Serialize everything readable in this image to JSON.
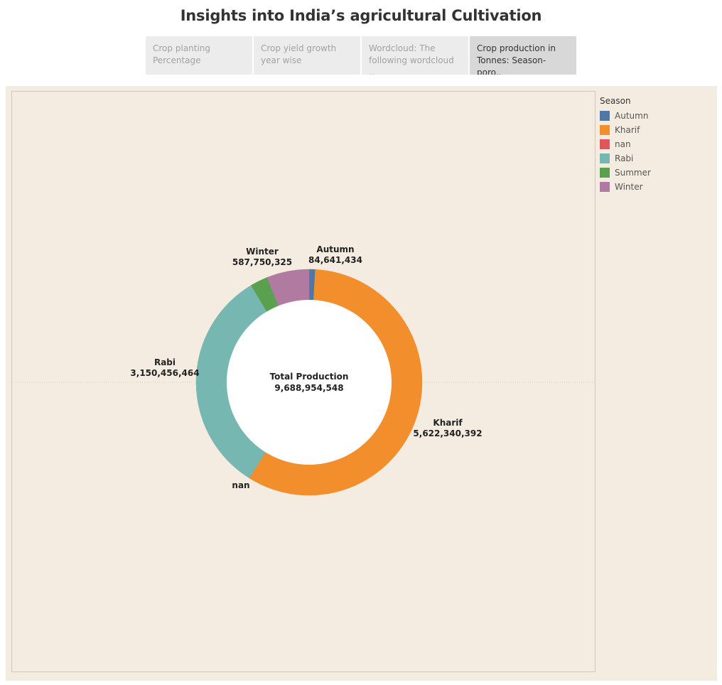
{
  "title": "Insights into India’s agricultural Cultivation",
  "tabs": [
    {
      "label": "Crop planting Percentage",
      "active": false
    },
    {
      "label": "Crop yield growth year wise",
      "active": false
    },
    {
      "label": "Wordcloud: The following wordcloud ..",
      "active": false
    },
    {
      "label": "Crop production in Tonnes: Season-poro..",
      "active": true
    }
  ],
  "colors": {
    "background": "#f5ece1",
    "Autumn": "#4e79a7",
    "Kharif": "#f28e2b",
    "nan": "#e15759",
    "Rabi": "#76b7b2",
    "Summer": "#59a14f",
    "Winter": "#b07aa1"
  },
  "legend": {
    "title": "Season",
    "items": [
      "Autumn",
      "Kharif",
      "nan",
      "Rabi",
      "Summer",
      "Winter"
    ]
  },
  "chart_data": {
    "type": "pie",
    "subtype": "donut",
    "center_label": "Total Production",
    "center_value": "9,688,954,548",
    "total": 9688954548,
    "slices": [
      {
        "name": "Autumn",
        "value": 84641434,
        "label": "84,641,434"
      },
      {
        "name": "Kharif",
        "value": 5622340392,
        "label": "5,622,340,392"
      },
      {
        "name": "nan",
        "value": 0,
        "label": ""
      },
      {
        "name": "Rabi",
        "value": 3150456464,
        "label": "3,150,456,464"
      },
      {
        "name": "Summer",
        "value": 243766233,
        "label": ""
      },
      {
        "name": "Winter",
        "value": 587750325,
        "label": "587,750,325"
      }
    ],
    "legend_position": "right"
  }
}
